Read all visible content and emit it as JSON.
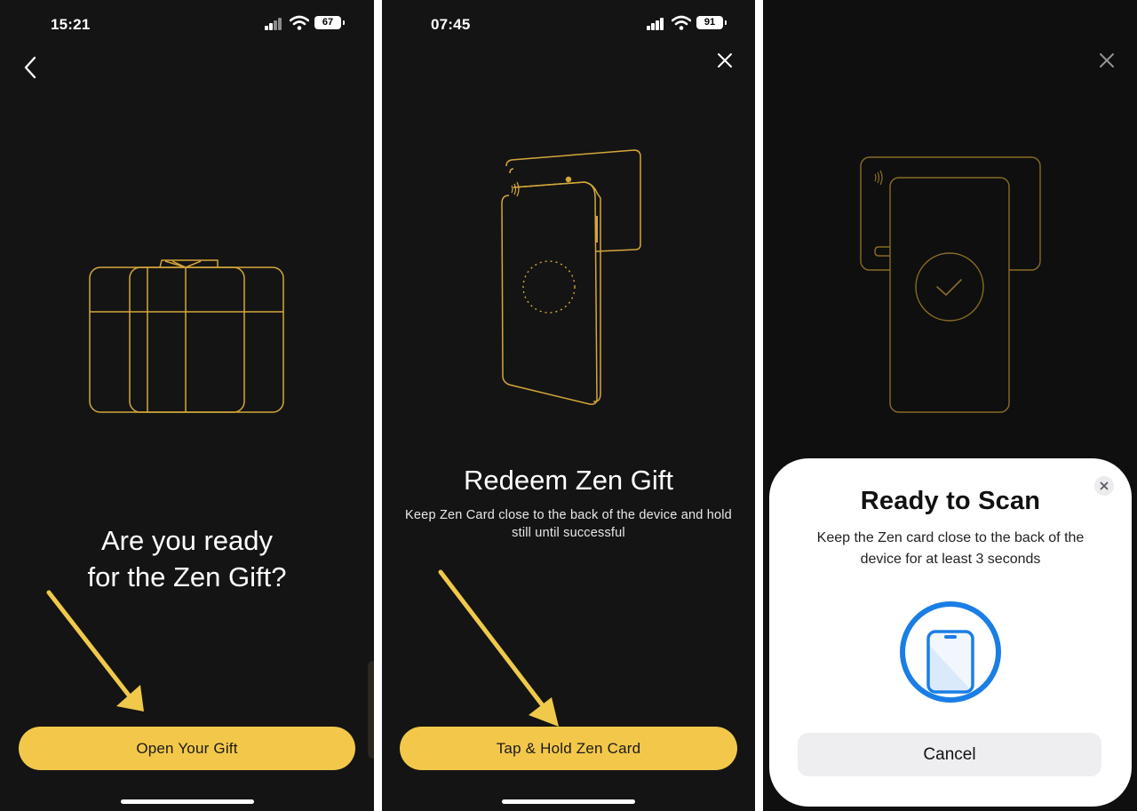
{
  "panels": [
    {
      "status": {
        "time": "15:21",
        "battery": "67"
      },
      "nav_icon": "back-chevron-icon",
      "illustration": "gift-box-icon",
      "title_line1": "Are you ready",
      "title_line2": "for the Zen Gift?",
      "button_label": "Open Your Gift"
    },
    {
      "status": {
        "time": "07:45",
        "battery": "91"
      },
      "nav_icon": "close-icon",
      "illustration": "phone-over-card-icon",
      "title": "Redeem Zen Gift",
      "subtitle_line1": "Keep Zen Card close to the back of the device and hold",
      "subtitle_line2": "still until successful",
      "button_label": "Tap & Hold Zen Card"
    },
    {
      "nav_icon": "close-icon",
      "illustration": "phone-card-check-icon",
      "sheet": {
        "title": "Ready to Scan",
        "text_line1": "Keep the Zen card close to the back of the",
        "text_line2": "device for at least 3 seconds",
        "icon": "nfc-phone-icon",
        "cancel_label": "Cancel"
      }
    }
  ],
  "colors": {
    "background": "#141414",
    "accent": "#f3c84a",
    "outline": "#d4a73a",
    "annotation_arrow": "#f0c94a",
    "scan_blue": "#1a7ee6"
  }
}
